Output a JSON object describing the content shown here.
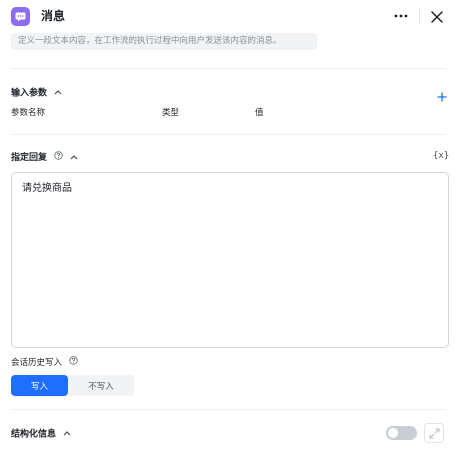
{
  "header": {
    "title": "消息",
    "icons": {
      "app": "message-icon",
      "more": "more-icon",
      "close": "close-icon"
    },
    "accent": "#8e6cf0"
  },
  "description": "定义一段文本内容，在工作流的执行过程中向用户发送该内容的消息。",
  "input_params": {
    "title": "输入参数",
    "columns": [
      "参数名称",
      "类型",
      "值"
    ]
  },
  "reply": {
    "title": "指定回复",
    "variable_icon": "{x}",
    "content": "请兑换商品"
  },
  "history": {
    "label": "会话历史写入",
    "options": [
      "写入",
      "不写入"
    ],
    "selected": "写入",
    "active_color": "#1e6fff"
  },
  "structured": {
    "title": "结构化信息",
    "enabled": false
  }
}
